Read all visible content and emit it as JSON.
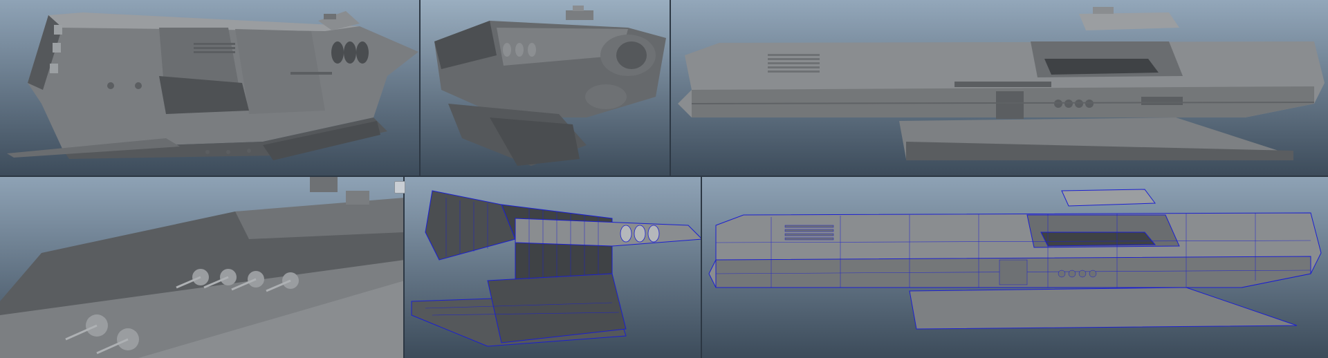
{
  "panels": [
    {
      "id": "hero-3q-left",
      "mode": "shaded"
    },
    {
      "id": "front-3q",
      "mode": "shaded"
    },
    {
      "id": "side-profile",
      "mode": "shaded"
    },
    {
      "id": "closeup-weapons",
      "mode": "shaded"
    },
    {
      "id": "front-3q-wire",
      "mode": "wireframe-on-shaded"
    },
    {
      "id": "side-profile-wire",
      "mode": "wireframe-on-shaded"
    }
  ],
  "colors": {
    "bg_top": "#8fa3b6",
    "bg_bottom": "#394858",
    "hull_light": "#8a8d90",
    "hull_mid": "#6e7174",
    "hull_dark": "#3e4144",
    "wire": "#1b1fd0"
  }
}
